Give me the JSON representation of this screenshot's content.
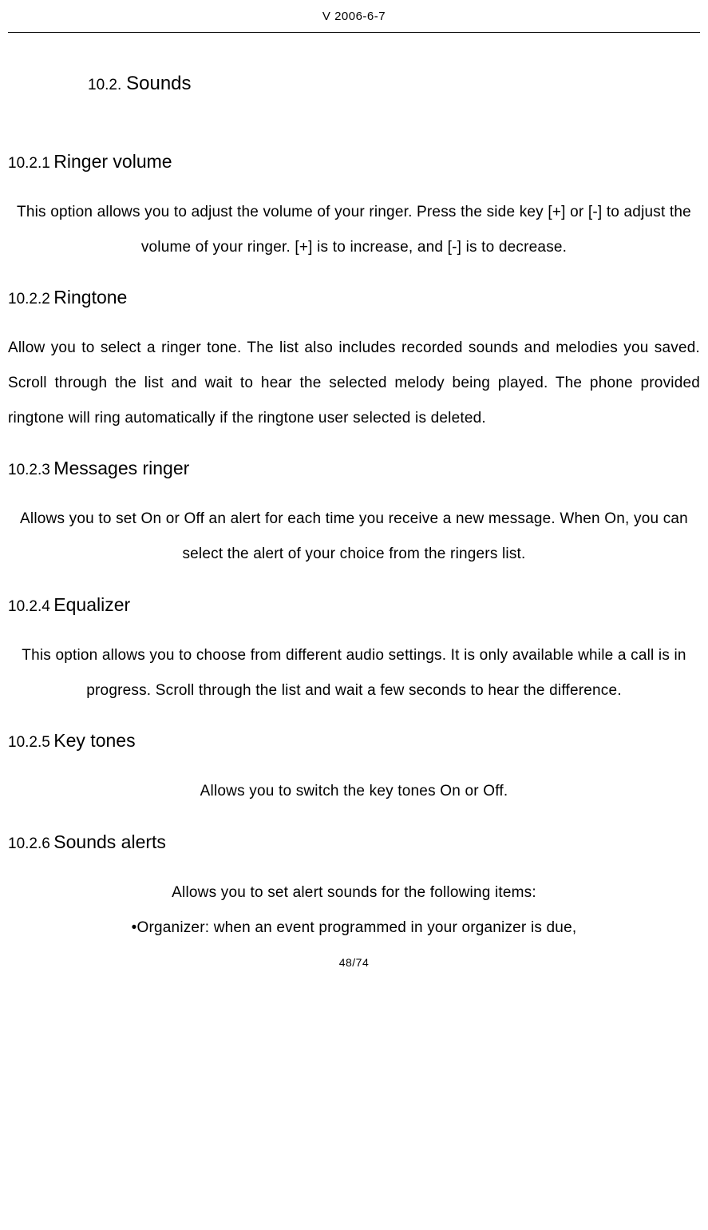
{
  "header": {
    "version": "V 2006-6-7"
  },
  "section10_2": {
    "num": "10.2.",
    "title": "Sounds"
  },
  "s10_2_1": {
    "num": "10.2.1",
    "title": "Ringer volume",
    "body": "This option allows you to adjust the volume of your ringer. Press the side key [+] or [-] to adjust the volume of your ringer. [+] is to increase, and [-] is to decrease."
  },
  "s10_2_2": {
    "num": "10.2.2",
    "title": "Ringtone",
    "body": "Allow you to select a ringer tone. The list also includes recorded sounds and melodies you saved. Scroll through the list and wait to hear the selected melody being played. The phone provided ringtone will ring automatically if the ringtone user selected is deleted."
  },
  "s10_2_3": {
    "num": "10.2.3",
    "title": "Messages ringer",
    "body": "Allows you to set On or Off an alert for each time you receive a new message. When On, you can select the alert of your choice from the ringers list."
  },
  "s10_2_4": {
    "num": "10.2.4",
    "title": "Equalizer",
    "body": "This option allows you to choose from different audio settings. It is only available while a call is in progress. Scroll through the list and wait a few seconds to hear the difference."
  },
  "s10_2_5": {
    "num": "10.2.5",
    "title": "Key tones",
    "body": "Allows you to switch the key tones On or Off."
  },
  "s10_2_6": {
    "num": "10.2.6",
    "title": "Sounds alerts",
    "body_line1": "Allows you to set alert sounds for the following items:",
    "body_line2": "•Organizer: when an event programmed in your organizer is due,"
  },
  "footer": {
    "page": "48/74"
  }
}
